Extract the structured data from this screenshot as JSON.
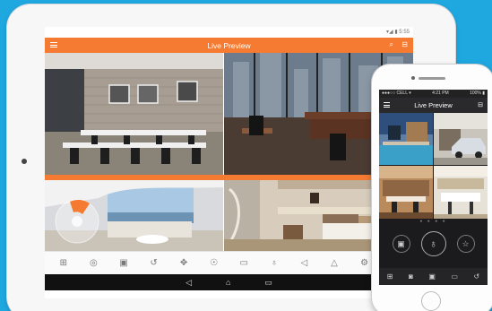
{
  "tablet": {
    "status_text": "▾◢ ▮ 5:55",
    "header": {
      "title": "Live Preview",
      "menu_icon": "hamburger-icon",
      "icons": [
        "search-icon",
        "device-icon"
      ]
    },
    "toolbar_icons": [
      {
        "name": "split-screen-icon",
        "glyph": "⊞"
      },
      {
        "name": "snapshot-icon",
        "glyph": "◎"
      },
      {
        "name": "record-icon",
        "glyph": "▣"
      },
      {
        "name": "playback-icon",
        "glyph": "↺"
      },
      {
        "name": "ptz-icon",
        "glyph": "✥"
      },
      {
        "name": "alarm-icon",
        "glyph": "☉"
      },
      {
        "name": "quality-icon",
        "glyph": "▭"
      },
      {
        "name": "microphone-icon",
        "glyph": "♁"
      },
      {
        "name": "volume-icon",
        "glyph": "◁"
      },
      {
        "name": "warning-icon",
        "glyph": "△"
      },
      {
        "name": "settings-icon",
        "glyph": "⚙"
      },
      {
        "name": "favorite-icon",
        "glyph": "☆"
      }
    ],
    "navbar": [
      {
        "name": "back-icon",
        "glyph": "◁"
      },
      {
        "name": "home-icon",
        "glyph": "⌂"
      },
      {
        "name": "recents-icon",
        "glyph": "▭"
      }
    ]
  },
  "phone": {
    "status": {
      "left": "●●●○○ CELL ▾",
      "center": "4:21 PM",
      "right": "100% ▮"
    },
    "header": {
      "title": "Live Preview",
      "menu_icon": "hamburger-icon",
      "icon": "device-icon"
    },
    "page_dots": "● ● ● ●",
    "controls": [
      {
        "name": "snapshot-icon",
        "glyph": "▣"
      },
      {
        "name": "microphone-icon",
        "glyph": "♁"
      },
      {
        "name": "favorite-icon",
        "glyph": "☆"
      }
    ],
    "bottom_icons": [
      {
        "name": "split-screen-icon",
        "glyph": "⊞"
      },
      {
        "name": "camera-icon",
        "glyph": "◙"
      },
      {
        "name": "record-icon",
        "glyph": "▣"
      },
      {
        "name": "quality-icon",
        "glyph": "▭"
      },
      {
        "name": "playback-icon",
        "glyph": "↺"
      }
    ]
  },
  "colors": {
    "accent": "#f57b32",
    "background": "#1fa8e0",
    "phone_dark": "#1b1b1d"
  }
}
